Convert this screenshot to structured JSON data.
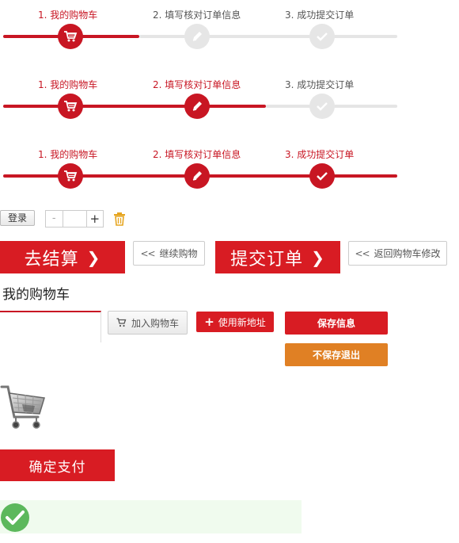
{
  "steps": {
    "labels": [
      "1. 我的购物车",
      "2. 填写核对订单信息",
      "3. 成功提交订单"
    ],
    "icons": [
      "cart-icon",
      "pencil-icon",
      "check-icon"
    ]
  },
  "progress_rows": [
    {
      "completed_steps": 1
    },
    {
      "completed_steps": 2
    },
    {
      "completed_steps": 3
    }
  ],
  "controls": {
    "login_label": "登录",
    "quantity_minus": "-",
    "quantity_value": "",
    "quantity_plus": "+"
  },
  "buttons": {
    "go_checkout": "去结算",
    "continue_shopping": "继续购物",
    "submit_order": "提交订单",
    "back_to_cart": "返回购物车修改",
    "add_to_cart": "加入购物车",
    "use_new_address": "使用新地址",
    "save_info": "保存信息",
    "no_save_exit": "不保存退出",
    "confirm_pay": "确定支付"
  },
  "cart_title": "我的购物车",
  "colors": {
    "accent_red": "#d81c23",
    "step_red": "#c81623",
    "orange": "#e08024",
    "success_green": "#5cb85c",
    "success_bg": "#f0fbee"
  }
}
